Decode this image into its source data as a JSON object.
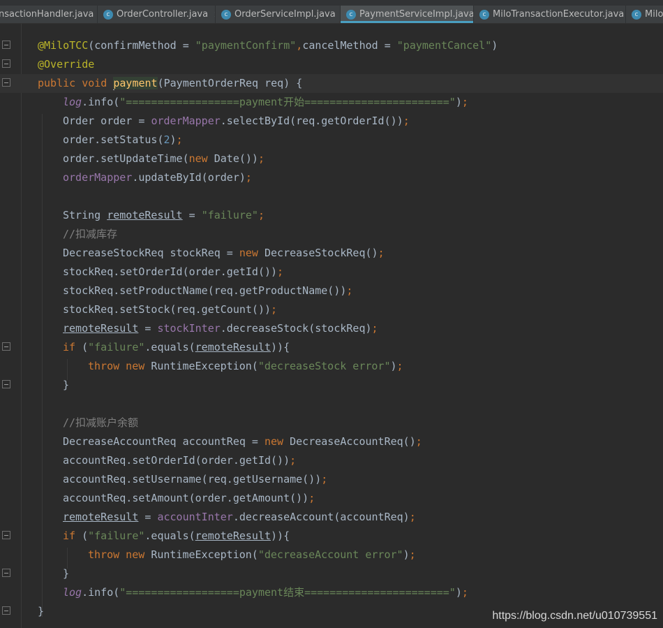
{
  "tabs": [
    {
      "label": "nsactionHandler.java",
      "icon": "class-icon",
      "active": false,
      "closable": true
    },
    {
      "label": "OrderController.java",
      "icon": "class-icon",
      "active": false,
      "closable": true
    },
    {
      "label": "OrderServiceImpl.java",
      "icon": "class-icon",
      "active": false,
      "closable": true
    },
    {
      "label": "PaymentServiceImpl.java",
      "icon": "class-icon",
      "active": true,
      "closable": true
    },
    {
      "label": "MiloTransactionExecutor.java",
      "icon": "class-icon",
      "active": false,
      "closable": true
    },
    {
      "label": "Milo",
      "icon": "class-icon",
      "active": false,
      "closable": false
    }
  ],
  "colors": {
    "background": "#2b2b2b",
    "keyword": "#cc7832",
    "string": "#6a8759",
    "annotation": "#bbb529",
    "field": "#9876aa",
    "number": "#6897bb",
    "comment": "#808080",
    "method": "#ffc66d",
    "accent": "#4a9fc1"
  },
  "code": [
    {
      "indent": 0,
      "fold": true,
      "t": [
        [
          "a",
          "@MiloTCC"
        ],
        [
          "p",
          "(confirmMethod = "
        ],
        [
          "s",
          "\"paymentConfirm\""
        ],
        [
          "k",
          ","
        ],
        [
          "p",
          "cancelMethod = "
        ],
        [
          "s",
          "\"paymentCancel\""
        ],
        [
          "p",
          ")"
        ]
      ]
    },
    {
      "indent": 0,
      "fold": true,
      "t": [
        [
          "a",
          "@Override"
        ]
      ]
    },
    {
      "indent": 0,
      "fold": true,
      "cur": true,
      "t": [
        [
          "k",
          "public void "
        ],
        [
          "m",
          "payment"
        ],
        [
          "p",
          "(PaymentOrderReq req) {"
        ]
      ]
    },
    {
      "indent": 1,
      "t": [
        [
          "lg",
          "log"
        ],
        [
          "p",
          ".info("
        ],
        [
          "s",
          "\"==================payment开始=======================\""
        ],
        [
          "p",
          ")"
        ],
        [
          "k",
          ";"
        ]
      ]
    },
    {
      "indent": 1,
      "t": [
        [
          "p",
          "Order order = "
        ],
        [
          "f",
          "orderMapper"
        ],
        [
          "p",
          ".selectById(req.getOrderId())"
        ],
        [
          "k",
          ";"
        ]
      ]
    },
    {
      "indent": 1,
      "t": [
        [
          "p",
          "order.setStatus("
        ],
        [
          "n",
          "2"
        ],
        [
          "p",
          ")"
        ],
        [
          "k",
          ";"
        ]
      ]
    },
    {
      "indent": 1,
      "t": [
        [
          "p",
          "order.setUpdateTime("
        ],
        [
          "k",
          "new "
        ],
        [
          "p",
          "Date())"
        ],
        [
          "k",
          ";"
        ]
      ]
    },
    {
      "indent": 1,
      "t": [
        [
          "f",
          "orderMapper"
        ],
        [
          "p",
          ".updateById(order)"
        ],
        [
          "k",
          ";"
        ]
      ]
    },
    {
      "indent": 1,
      "t": []
    },
    {
      "indent": 1,
      "t": [
        [
          "p",
          "String "
        ],
        [
          "pu",
          "remoteResult"
        ],
        [
          "p",
          " = "
        ],
        [
          "s",
          "\"failure\""
        ],
        [
          "k",
          ";"
        ]
      ]
    },
    {
      "indent": 1,
      "t": [
        [
          "c",
          "//扣减库存"
        ]
      ]
    },
    {
      "indent": 1,
      "t": [
        [
          "p",
          "DecreaseStockReq stockReq = "
        ],
        [
          "k",
          "new "
        ],
        [
          "p",
          "DecreaseStockReq()"
        ],
        [
          "k",
          ";"
        ]
      ]
    },
    {
      "indent": 1,
      "t": [
        [
          "p",
          "stockReq.setOrderId(order.getId())"
        ],
        [
          "k",
          ";"
        ]
      ]
    },
    {
      "indent": 1,
      "t": [
        [
          "p",
          "stockReq.setProductName(req.getProductName())"
        ],
        [
          "k",
          ";"
        ]
      ]
    },
    {
      "indent": 1,
      "t": [
        [
          "p",
          "stockReq.setStock(req.getCount())"
        ],
        [
          "k",
          ";"
        ]
      ]
    },
    {
      "indent": 1,
      "t": [
        [
          "pu",
          "remoteResult"
        ],
        [
          "p",
          " = "
        ],
        [
          "f",
          "stockInter"
        ],
        [
          "p",
          ".decreaseStock(stockReq)"
        ],
        [
          "k",
          ";"
        ]
      ]
    },
    {
      "indent": 1,
      "fold": true,
      "t": [
        [
          "k",
          "if "
        ],
        [
          "p",
          "("
        ],
        [
          "s",
          "\"failure\""
        ],
        [
          "p",
          ".equals("
        ],
        [
          "pu",
          "remoteResult"
        ],
        [
          "p",
          "))"
        ],
        [
          "p",
          "{"
        ]
      ]
    },
    {
      "indent": 2,
      "t": [
        [
          "k",
          "throw new "
        ],
        [
          "p",
          "RuntimeException("
        ],
        [
          "s",
          "\"decreaseStock error\""
        ],
        [
          "p",
          ")"
        ],
        [
          "k",
          ";"
        ]
      ]
    },
    {
      "indent": 1,
      "fold": true,
      "t": [
        [
          "p",
          "}"
        ]
      ]
    },
    {
      "indent": 1,
      "t": []
    },
    {
      "indent": 1,
      "t": [
        [
          "c",
          "//扣减账户余额"
        ]
      ]
    },
    {
      "indent": 1,
      "t": [
        [
          "p",
          "DecreaseAccountReq accountReq = "
        ],
        [
          "k",
          "new "
        ],
        [
          "p",
          "DecreaseAccountReq()"
        ],
        [
          "k",
          ";"
        ]
      ]
    },
    {
      "indent": 1,
      "t": [
        [
          "p",
          "accountReq.setOrderId(order.getId())"
        ],
        [
          "k",
          ";"
        ]
      ]
    },
    {
      "indent": 1,
      "t": [
        [
          "p",
          "accountReq.setUsername(req.getUsername())"
        ],
        [
          "k",
          ";"
        ]
      ]
    },
    {
      "indent": 1,
      "t": [
        [
          "p",
          "accountReq.setAmount(order.getAmount())"
        ],
        [
          "k",
          ";"
        ]
      ]
    },
    {
      "indent": 1,
      "t": [
        [
          "pu",
          "remoteResult"
        ],
        [
          "p",
          " = "
        ],
        [
          "f",
          "accountInter"
        ],
        [
          "p",
          ".decreaseAccount(accountReq)"
        ],
        [
          "k",
          ";"
        ]
      ]
    },
    {
      "indent": 1,
      "fold": true,
      "t": [
        [
          "k",
          "if "
        ],
        [
          "p",
          "("
        ],
        [
          "s",
          "\"failure\""
        ],
        [
          "p",
          ".equals("
        ],
        [
          "pu",
          "remoteResult"
        ],
        [
          "p",
          "))"
        ],
        [
          "p",
          "{"
        ]
      ]
    },
    {
      "indent": 2,
      "t": [
        [
          "k",
          "throw new "
        ],
        [
          "p",
          "RuntimeException("
        ],
        [
          "s",
          "\"decreaseAccount error\""
        ],
        [
          "p",
          ")"
        ],
        [
          "k",
          ";"
        ]
      ]
    },
    {
      "indent": 1,
      "fold": true,
      "t": [
        [
          "p",
          "}"
        ]
      ]
    },
    {
      "indent": 1,
      "t": [
        [
          "lg",
          "log"
        ],
        [
          "p",
          ".info("
        ],
        [
          "s",
          "\"==================payment结束=======================\""
        ],
        [
          "p",
          ")"
        ],
        [
          "k",
          ";"
        ]
      ]
    },
    {
      "indent": 0,
      "fold": true,
      "t": [
        [
          "p",
          "}"
        ]
      ]
    }
  ],
  "watermark": "https://blog.csdn.net/u010739551"
}
